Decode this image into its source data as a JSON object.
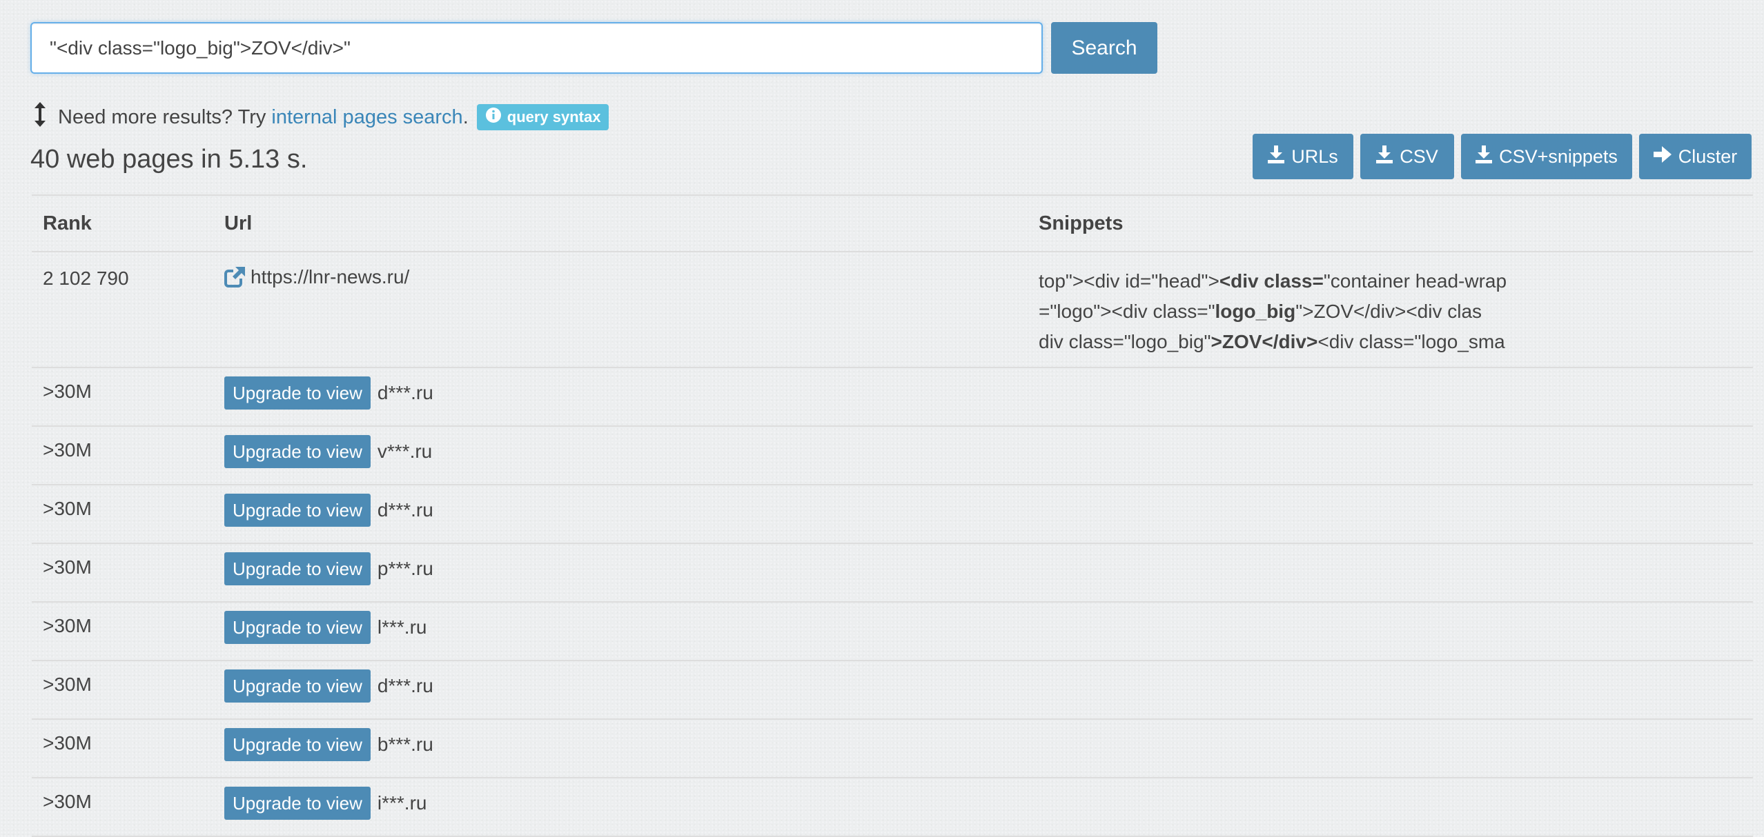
{
  "search": {
    "value": "\"<div class=\"logo_big\">ZOV</div>\"",
    "button_label": "Search"
  },
  "hint": {
    "prefix": "Need more results? Try",
    "link_label": "internal pages search",
    "suffix": ".",
    "syntax_label": "query syntax"
  },
  "results_summary": "40 web pages in 5.13 s.",
  "actions": [
    {
      "label": "URLs"
    },
    {
      "label": "CSV"
    },
    {
      "label": "CSV+snippets"
    },
    {
      "label": "Cluster"
    }
  ],
  "table": {
    "headers": {
      "rank": "Rank",
      "url": "Url",
      "snippets": "Snippets"
    },
    "first_row": {
      "rank": "2 102 790",
      "url": "https://lnr-news.ru/",
      "snippet_parts": [
        [
          {
            "t": "top\">",
            "b": false
          },
          {
            "t": "<div id=\"head\">",
            "b": false
          },
          {
            "t": "<div class=",
            "b": true
          },
          {
            "t": "\"container head-wrap",
            "b": false
          }
        ],
        [
          {
            "t": "=\"logo\"><div class=\"",
            "b": false
          },
          {
            "t": "logo_big",
            "b": true
          },
          {
            "t": "\">ZOV</div><div clas",
            "b": false
          }
        ],
        [
          {
            "t": "div class=\"logo_big\"",
            "b": false
          },
          {
            "t": ">ZOV</div>",
            "b": true
          },
          {
            "t": "<div class=\"logo_sma",
            "b": false
          }
        ]
      ]
    },
    "upgrade_label": "Upgrade to view",
    "locked_rows": [
      {
        "rank": ">30M",
        "url": "d***.ru"
      },
      {
        "rank": ">30M",
        "url": "v***.ru"
      },
      {
        "rank": ">30M",
        "url": "d***.ru"
      },
      {
        "rank": ">30M",
        "url": "p***.ru"
      },
      {
        "rank": ">30M",
        "url": "l***.ru"
      },
      {
        "rank": ">30M",
        "url": "d***.ru"
      },
      {
        "rank": ">30M",
        "url": "b***.ru"
      },
      {
        "rank": ">30M",
        "url": "i***.ru"
      }
    ]
  },
  "colors": {
    "primary_button": "#4d8bb5",
    "info_badge": "#5bc0de",
    "link": "#3a86b8",
    "input_focus_border": "#66afe9"
  },
  "icons": {
    "hint": "vertical-arrows-icon",
    "syntax": "info-circle-icon",
    "download": "download-icon",
    "cluster": "arrow-right-icon",
    "external_link": "external-link-icon"
  }
}
